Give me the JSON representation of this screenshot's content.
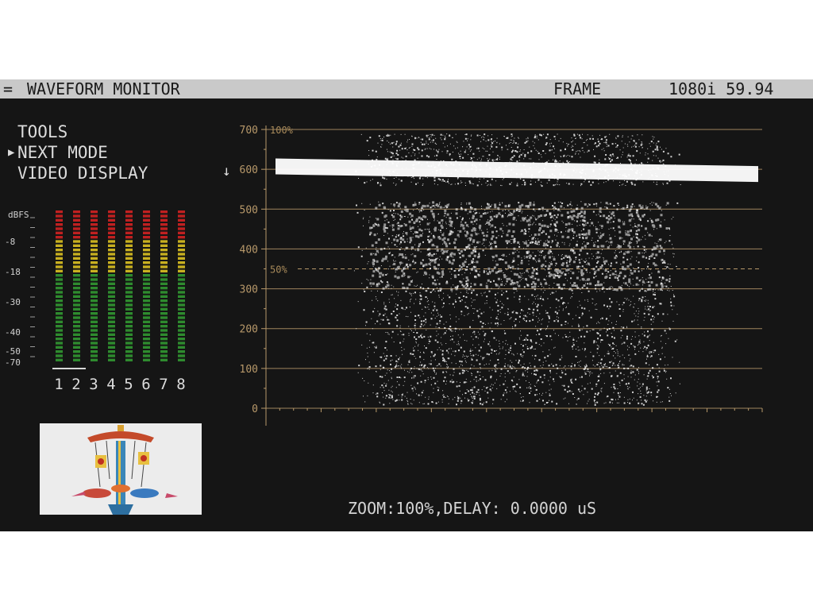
{
  "header": {
    "menu_glyph": "=",
    "title": "WAVEFORM MONITOR",
    "mode": "FRAME",
    "format": "1080i 59.94"
  },
  "menu": {
    "items": [
      {
        "label": "TOOLS",
        "selected": false
      },
      {
        "label": "NEXT MODE",
        "selected": true
      },
      {
        "label": "VIDEO DISPLAY",
        "selected": false
      }
    ],
    "selection_icon": "triangle-right-icon"
  },
  "cursor_icon": "down-arrow-icon",
  "audio": {
    "scale_unit": "dBFS",
    "scale_labels": [
      "-8",
      "-18",
      "-30",
      "-40",
      "-50",
      "-70"
    ],
    "channels": [
      "1",
      "2",
      "3",
      "4",
      "5",
      "6",
      "7",
      "8"
    ],
    "colors": {
      "low": "#2e8b2e",
      "mid": "#c8b020",
      "high": "#c02020"
    },
    "segment_count": 36,
    "level_fraction": [
      1,
      1,
      1,
      1,
      1,
      1,
      1,
      1
    ],
    "pair_indicator": "1-2"
  },
  "thumbnail": {
    "subject": "carousel swing ride toy",
    "background": "#ececec"
  },
  "scope": {
    "mode": "waveform",
    "y_ticks": [
      "700",
      "600",
      "500",
      "400",
      "300",
      "200",
      "100",
      "0"
    ],
    "ref_100": "100%",
    "ref_50": "50%",
    "graticule_color": "#b8996a",
    "trace_color": "#ffffff"
  },
  "status": {
    "text": "ZOOM:100%,DELAY: 0.0000 uS"
  }
}
